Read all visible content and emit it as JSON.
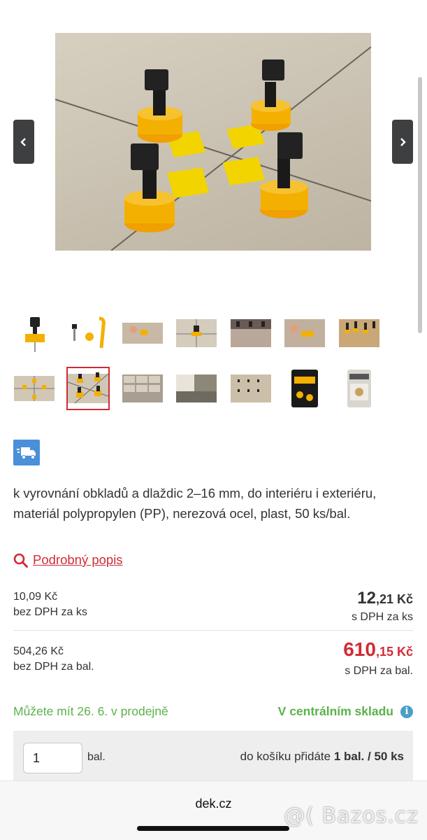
{
  "gallery": {
    "main_image_alt": "",
    "thumbnail_count": 14,
    "selected_index": 8
  },
  "description": "k vyrovnání obkladů a dlaždic 2–16 mm, do interiéru i exteriéru, materiál polypropylen (PP), nerezová ocel, plast, 50 ks/bal.",
  "detail_link": "Podrobný popis",
  "prices": {
    "per_piece": {
      "net": "10,09 Kč",
      "net_label": "bez DPH za ks",
      "gross_int": "12",
      "gross_dec": ",21 Kč",
      "gross_label": "s DPH za ks"
    },
    "per_pack": {
      "net": "504,26 Kč",
      "net_label": "bez DPH za bal.",
      "gross_int": "610",
      "gross_dec": ",15 Kč",
      "gross_label": "s DPH za bal."
    }
  },
  "availability": {
    "store": "Můžete mít 26. 6. v prodejně",
    "central": "V centrálním skladu",
    "info_glyph": "i"
  },
  "cart": {
    "quantity": "1",
    "unit": "bal.",
    "summary_prefix": "do košíku přidáte ",
    "summary_bold": "1 bal. / 50 ks"
  },
  "browser": {
    "url": "dek.cz"
  },
  "watermark": "@( Bazos.cz",
  "colors": {
    "accent_red": "#d12b36",
    "available_green": "#5bb24a",
    "delivery_blue": "#4a90d9"
  },
  "icons": {
    "prev": "chevron-left-icon",
    "next": "chevron-right-icon",
    "delivery": "delivery-truck-icon",
    "search": "search-icon",
    "info": "info-icon"
  }
}
